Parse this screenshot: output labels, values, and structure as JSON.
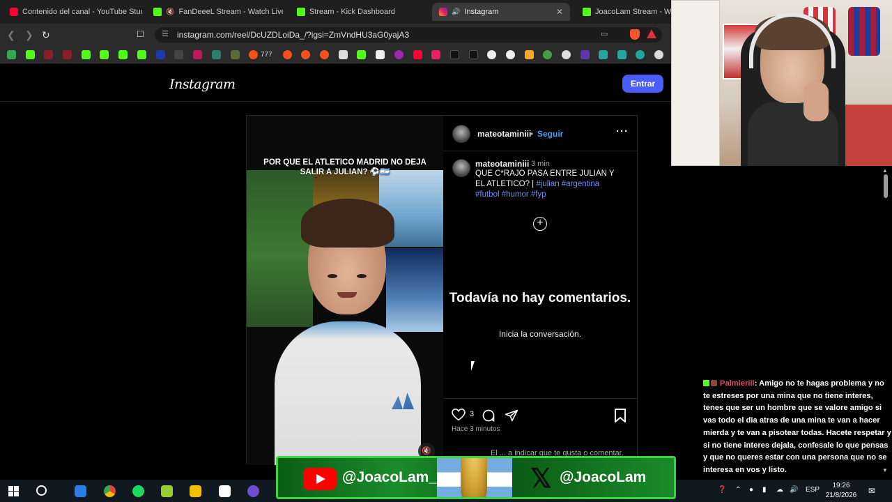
{
  "browser": {
    "tabs": [
      {
        "title": "Contenido del canal - YouTube Studio",
        "icon": "youtube-studio-icon"
      },
      {
        "title": "FanDeeeL Stream - Watch Live on Kick",
        "icon": "kick-icon"
      },
      {
        "title": "Stream - Kick Dashboard",
        "icon": "kick-icon"
      },
      {
        "title": "Instagram",
        "icon": "instagram-icon",
        "active": true
      },
      {
        "title": "JoacoLam Stream - Watch Live on Kick",
        "icon": "kick-icon"
      }
    ],
    "url": "instagram.com/reel/DcUZDLoiDa_/?igsi=ZmVndHU3aG0yajA3",
    "bookmark_text": "777"
  },
  "instagram": {
    "logo": "Instagram",
    "login_button": "Entrar",
    "post": {
      "video_caption": "POR QUE EL ATLETICO MADRID NO DEJA SALIR A JULIAN? ⚽🇦🇷",
      "username": "mateotaminiii",
      "follow_label": "Seguir",
      "comment_username": "mateotaminiii",
      "comment_time": "3 min",
      "caption_text": "QUE C*RAJO PASA ENTRE JULIAN Y EL ATLETICO? | ",
      "hashtags": "#julian #argentina #futbol #humor #fyp",
      "no_comments_title": "Todavía no hay comentarios.",
      "no_comments_sub": "Inicia la conversación.",
      "likes": "3",
      "posted_ago": "Hace 3 minutos",
      "login_prompt": "El ... a indicar que te gusta o comentar."
    }
  },
  "stream_chat": {
    "username": "Palmieriii",
    "message": ": Amigo no te hagas problema y no te estreses por una mina que no tiene interes, tenes que ser un hombre que se valore amigo si vas todo el dia atras de una mina te van a hacer mierda y te van a pisotear todas. Hacete respetar y si no tiene interes dejala, confesale lo que pensas y que no queres estar con una persona que no se interesa en vos y listo."
  },
  "overlay": {
    "youtube_handle": "@JoacoLam_",
    "x_handle": "@JoacoLam"
  },
  "taskbar": {
    "language": "ESP",
    "time": "19:26",
    "date": "21/8/2026"
  },
  "colors": {
    "instagram_blue": "#4a5df9",
    "link_blue": "#4a9cf5",
    "hashtag": "#6f8ff3",
    "chat_user": "#e64d6a",
    "kick_green": "#53fc18"
  }
}
